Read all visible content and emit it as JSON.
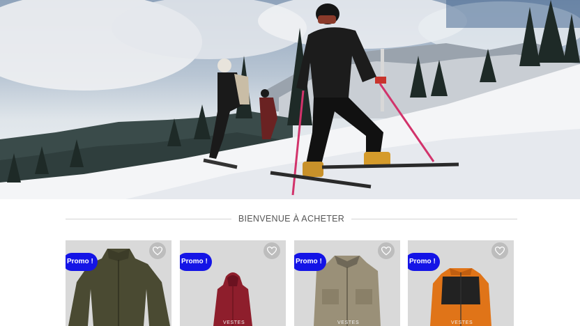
{
  "hero": {
    "image": "skiers-on-snowy-mountain-photo"
  },
  "section": {
    "title": "BIENVENUE À ACHETER"
  },
  "products": [
    {
      "promo": "Promo !",
      "image": "olive-fleece-jacket",
      "tag": "",
      "wishlist_icon": "heart-icon"
    },
    {
      "promo": "Promo !",
      "image": "red-hooded-jacket",
      "tag": "VESTES",
      "wishlist_icon": "heart-icon"
    },
    {
      "promo": "Promo !",
      "image": "beige-utility-vest",
      "tag": "VESTES",
      "wishlist_icon": "heart-icon"
    },
    {
      "promo": "Promo !",
      "image": "orange-black-fleece",
      "tag": "VESTES",
      "wishlist_icon": "heart-icon"
    }
  ],
  "colors": {
    "promo_badge": "#1414e6",
    "card_background": "#d9d9d9"
  }
}
